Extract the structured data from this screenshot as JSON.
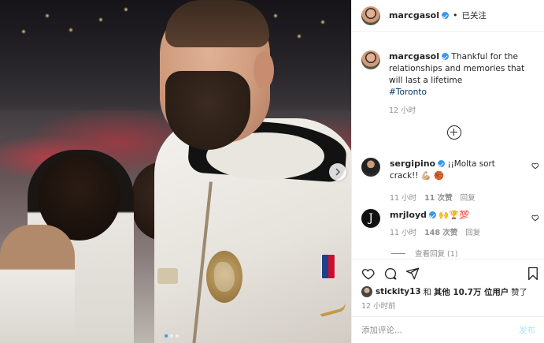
{
  "post": {
    "author": "marcgasol",
    "follow_status": "已关注",
    "separator": "•",
    "caption": {
      "username": "marcgasol",
      "text": "Thankful for the relationships and memories that will last a lifetime",
      "hashtag": "#Toronto",
      "time": "12 小时"
    }
  },
  "comments": [
    {
      "username": "sergipino",
      "text": "¡¡Molta sort crack!! 💪🏼 🏀",
      "time": "11 小时",
      "likes": "11 次赞",
      "reply": "回复"
    },
    {
      "username": "mrjloyd",
      "avatar_letter": "J",
      "text": "🙌🏆💯",
      "time": "11 小时",
      "likes": "148 次赞",
      "reply": "回复"
    }
  ],
  "view_replies": "查看回复 (1)",
  "likes": {
    "username": "stickity13",
    "connector": "和",
    "others": "其他 10.7万 位用户",
    "suffix": "赞了"
  },
  "post_time": "12 小时前",
  "comment_box": {
    "placeholder": "添加评论...",
    "publish": "发布"
  },
  "icons": {
    "like": "heart-icon",
    "comment": "comment-icon",
    "share": "share-icon",
    "save": "bookmark-icon",
    "add": "plus-circle-icon",
    "next": "chevron-right-icon"
  },
  "colors": {
    "verified": "#3897f0",
    "hashtag": "#00376b",
    "muted": "#8e8e8e",
    "publish_disabled": "#b2dffc"
  }
}
